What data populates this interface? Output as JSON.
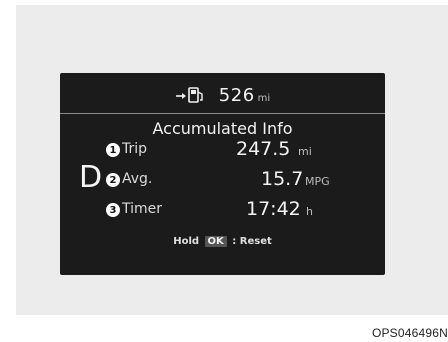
{
  "display": {
    "range": {
      "value": "526",
      "unit": "mi",
      "icon": "fuel-pump-arrow-icon"
    },
    "title": "Accumulated Info",
    "gear": "D",
    "rows": [
      {
        "badge": "1",
        "label": "Trip",
        "value": "247.5",
        "unit": "mi"
      },
      {
        "badge": "2",
        "label": "Avg.",
        "value": "15.7",
        "unit": "MPG"
      },
      {
        "badge": "3",
        "label": "Timer",
        "value": "17:42",
        "unit": "h"
      }
    ],
    "hold": {
      "prefix": "Hold",
      "key": "OK",
      "suffix": ": Reset"
    }
  },
  "figure_code": "OPS046496N",
  "colors": {
    "screen_bg": "#1b1b1b",
    "panel_bg": "#ececec",
    "text": "#f2f2f2"
  }
}
